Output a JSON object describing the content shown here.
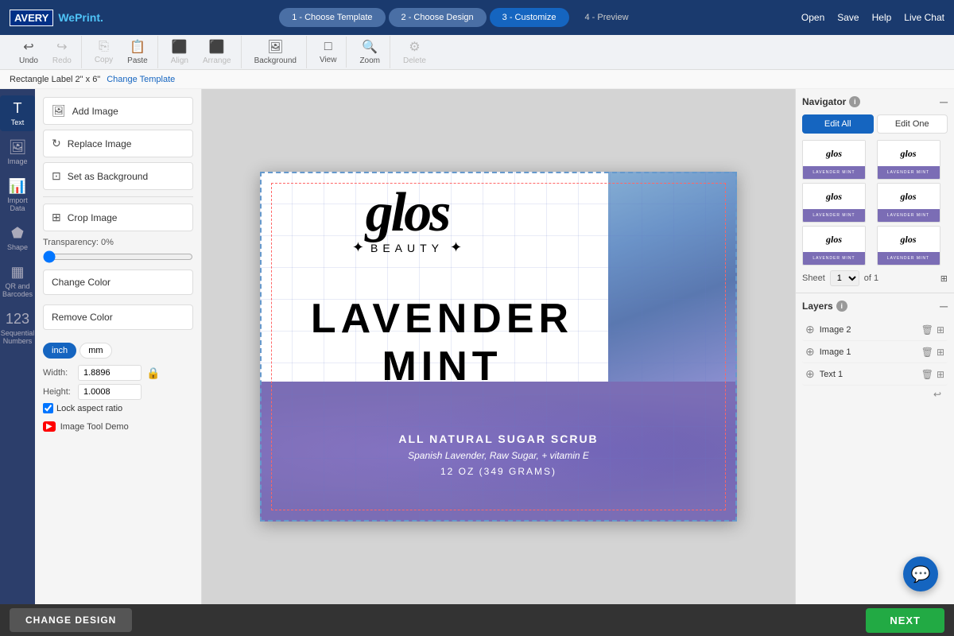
{
  "brand": {
    "avery": "AVERY",
    "weprint": "WePrint",
    "dot": "."
  },
  "steps": [
    {
      "id": "step1",
      "label": "1 - Choose Template",
      "state": "completed"
    },
    {
      "id": "step2",
      "label": "2 - Choose Design",
      "state": "completed"
    },
    {
      "id": "step3",
      "label": "3 - Customize",
      "state": "active"
    },
    {
      "id": "step4",
      "label": "4 - Preview",
      "state": "default"
    }
  ],
  "top_actions": {
    "open": "Open",
    "save": "Save",
    "help": "Help",
    "live_chat": "Live Chat"
  },
  "toolbar": {
    "undo": "Undo",
    "redo": "Redo",
    "copy": "Copy",
    "paste": "Paste",
    "align": "Align",
    "arrange": "Arrange",
    "background": "Background",
    "view": "View",
    "zoom": "Zoom",
    "delete": "Delete"
  },
  "subtitle": {
    "label": "Rectangle Label 2\" x 6\"",
    "change_template": "Change Template"
  },
  "sidebar": {
    "items": [
      {
        "id": "text",
        "label": "Text",
        "icon": "T"
      },
      {
        "id": "image",
        "label": "Image",
        "icon": "🖼"
      },
      {
        "id": "import",
        "label": "Import Data",
        "icon": "📊"
      },
      {
        "id": "shape",
        "label": "Shape",
        "icon": "⬟"
      },
      {
        "id": "qr",
        "label": "QR and Barcodes",
        "icon": "▦"
      },
      {
        "id": "sequential",
        "label": "Sequential Numbers",
        "icon": "123"
      }
    ]
  },
  "tools": {
    "add_image": "Add Image",
    "replace_image": "Replace Image",
    "set_as_background": "Set as Background",
    "crop_image": "Crop Image",
    "transparency_label": "Transparency: 0%",
    "change_color": "Change Color",
    "remove_color": "Remove Color",
    "unit_inch": "inch",
    "unit_mm": "mm",
    "width_label": "Width:",
    "width_value": "1.8896",
    "height_label": "Height:",
    "height_value": "1.0008",
    "lock_ratio": "Lock aspect ratio",
    "demo_label": "Image Tool Demo"
  },
  "canvas": {
    "logo_text": "glos",
    "beauty_text": "BEAUTY",
    "lavender_mint": "LAVENDER  MINT",
    "sugar_scrub": "ALL NATURAL SUGAR SCRUB",
    "ingredients": "Spanish Lavender, Raw Sugar, + vitamin E",
    "oz_text": "12 OZ (349 GRAMS)"
  },
  "navigator": {
    "title": "Navigator",
    "edit_all": "Edit All",
    "edit_one": "Edit One",
    "sheet_label": "Sheet",
    "sheet_value": "1",
    "of_label": "of 1"
  },
  "layers": {
    "title": "Layers",
    "items": [
      {
        "id": "image2",
        "label": "Image 2"
      },
      {
        "id": "image1",
        "label": "Image 1"
      },
      {
        "id": "text1",
        "label": "Text 1"
      }
    ]
  },
  "bottom_bar": {
    "change_design": "CHANGE DESIGN",
    "next": "NEXT"
  },
  "chat_fab_icon": "💬"
}
